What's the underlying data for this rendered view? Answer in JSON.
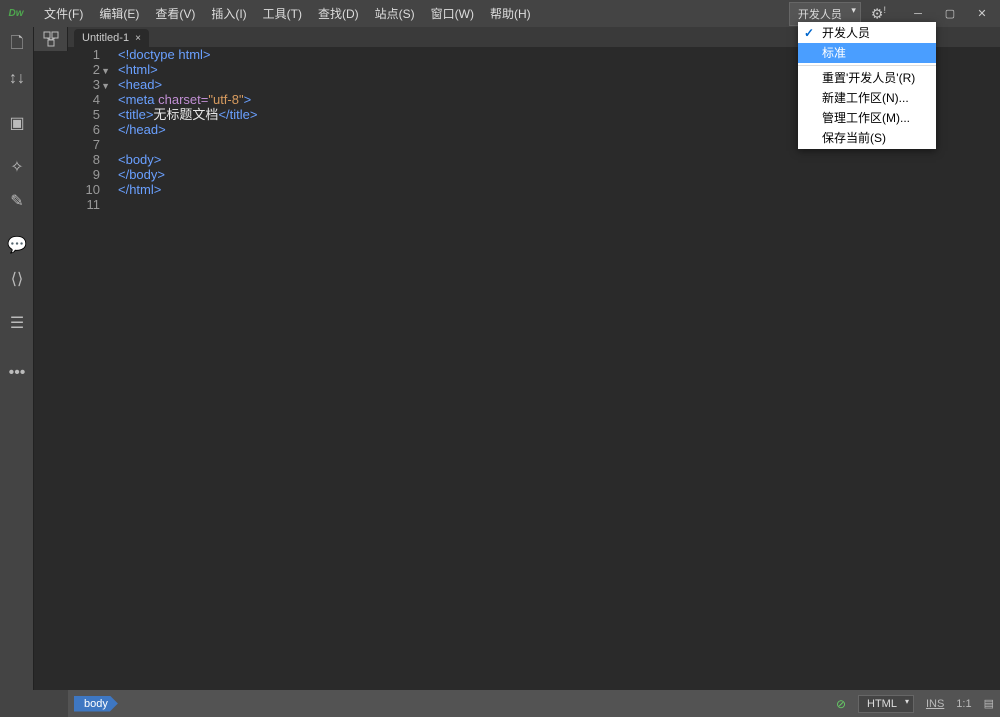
{
  "logo": "Dw",
  "menu": [
    "文件(F)",
    "编辑(E)",
    "查看(V)",
    "插入(I)",
    "工具(T)",
    "查找(D)",
    "站点(S)",
    "窗口(W)",
    "帮助(H)"
  ],
  "workspace_label": "开发人员",
  "dropdown": {
    "items": [
      {
        "label": "开发人员",
        "checked": true
      },
      {
        "label": "标准",
        "highlighted": true
      }
    ],
    "items2": [
      {
        "label": "重置'开发人员'(R)"
      },
      {
        "label": "新建工作区(N)..."
      },
      {
        "label": "管理工作区(M)..."
      },
      {
        "label": "保存当前(S)"
      }
    ]
  },
  "tab": {
    "title": "Untitled-1",
    "close": "×"
  },
  "code": {
    "lines": [
      {
        "n": 1,
        "html": "<span class='tag'>&lt;!doctype html&gt;</span>"
      },
      {
        "n": 2,
        "fold": "▼",
        "html": "<span class='tag'>&lt;html&gt;</span>"
      },
      {
        "n": 3,
        "fold": "▼",
        "html": "<span class='tag'>&lt;head&gt;</span>"
      },
      {
        "n": 4,
        "html": "<span class='tag'>&lt;meta </span><span class='attr'>charset=</span><span class='str'>\"utf-8\"</span><span class='tag'>&gt;</span>"
      },
      {
        "n": 5,
        "html": "<span class='tag'>&lt;title&gt;</span><span class='txt'>无标题文档</span><span class='tag'>&lt;/title&gt;</span>"
      },
      {
        "n": 6,
        "html": "<span class='tag'>&lt;/head&gt;</span>"
      },
      {
        "n": 7,
        "html": ""
      },
      {
        "n": 8,
        "html": "<span class='tag'>&lt;body&gt;</span>"
      },
      {
        "n": 9,
        "html": "<span class='tag'>&lt;/body&gt;</span>"
      },
      {
        "n": 10,
        "html": "<span class='tag'>&lt;/html&gt;</span>"
      },
      {
        "n": 11,
        "html": ""
      }
    ]
  },
  "breadcrumb": "body",
  "status": {
    "lang": "HTML",
    "ins": "INS",
    "pos": "1:1"
  }
}
